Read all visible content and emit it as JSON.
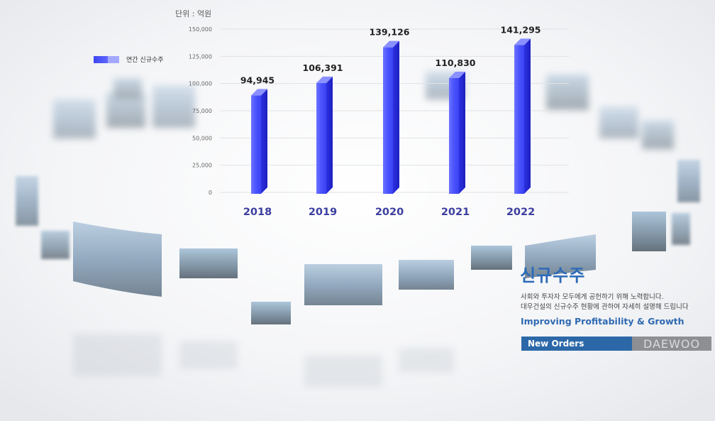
{
  "chart_data": {
    "type": "bar",
    "unit_label": "단위 : 억원",
    "legend": "연간 신규수주",
    "categories": [
      "2018",
      "2019",
      "2020",
      "2021",
      "2022"
    ],
    "series": [
      {
        "name": "연간 신규수주",
        "values": [
          94945,
          106391,
          139126,
          110830,
          141295
        ]
      }
    ],
    "value_labels": [
      "94,945",
      "106,391",
      "139,126",
      "110,830",
      "141,295"
    ],
    "y_ticks": [
      0,
      25000,
      50000,
      75000,
      100000,
      125000,
      150000
    ],
    "y_tick_labels": [
      "0",
      "25,000",
      "50,000",
      "75,000",
      "100,000",
      "125,000",
      "150,000"
    ],
    "ylim": [
      0,
      150000
    ],
    "grid": true,
    "legend_position": "top-left",
    "colors": {
      "bar_front": "#4a53ff",
      "bar_side": "#2a2ee0",
      "bar_top": "#8a90ff",
      "category_label": "#3b3f9e"
    }
  },
  "side_panel": {
    "title": "신규수주",
    "description_line1": "사회와 투자자 모두에게 공헌하기 위해 노력합니다.",
    "description_line2": "대우건설의 신규수주 현황에 관하여 자세히 설명해 드립니다",
    "tagline": "Improving Profitability & Growth",
    "banner_label": "New Orders",
    "brand": "DAEWOO"
  }
}
